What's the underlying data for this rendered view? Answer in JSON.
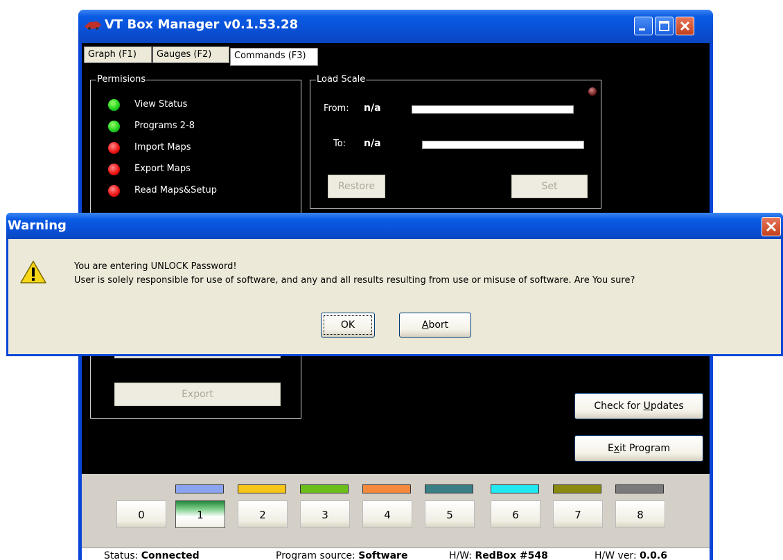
{
  "window": {
    "title": "VT Box Manager v0.1.53.28",
    "buttons": {
      "minimize": "_",
      "maximize": "□",
      "close": "✕"
    }
  },
  "tabs": [
    {
      "label": "Graph (F1)",
      "active": false
    },
    {
      "label": "Gauges (F2)",
      "active": false
    },
    {
      "label": "Commands (F3)",
      "active": true
    }
  ],
  "permissions": {
    "legend": "Permisions",
    "items": [
      {
        "label": "View Status",
        "state": "green"
      },
      {
        "label": "Programs 2-8",
        "state": "green"
      },
      {
        "label": "Import Maps",
        "state": "red"
      },
      {
        "label": "Export Maps",
        "state": "red"
      },
      {
        "label": "Read Maps&Setup",
        "state": "red"
      }
    ],
    "export_button": "Export"
  },
  "load_scale": {
    "legend": "Load Scale",
    "from_label": "From:",
    "from_value": "n/a",
    "to_label": "To:",
    "to_value": "n/a",
    "restore_button": "Restore",
    "set_button": "Set"
  },
  "actions": {
    "check_updates_pre": "Check for ",
    "check_updates_acc": "U",
    "check_updates_post": "pdates",
    "exit_pre": "E",
    "exit_acc": "x",
    "exit_post": "it Program"
  },
  "programs": [
    {
      "label": "0",
      "color": ""
    },
    {
      "label": "1",
      "color": "#8aa4f0",
      "active": true
    },
    {
      "label": "2",
      "color": "#f5c518"
    },
    {
      "label": "3",
      "color": "#6cbf1a"
    },
    {
      "label": "4",
      "color": "#f58a3c"
    },
    {
      "label": "5",
      "color": "#3a7f86"
    },
    {
      "label": "6",
      "color": "#22e8f0"
    },
    {
      "label": "7",
      "color": "#8a8a10"
    },
    {
      "label": "8",
      "color": "#7a7a7a"
    }
  ],
  "status": {
    "status_label": "Status: ",
    "status_value": "Connected",
    "source_label": "Program source: ",
    "source_value": "Software",
    "hw_label": "H/W: ",
    "hw_value": "RedBox #548",
    "hwver_label": "H/W ver: ",
    "hwver_value": "0.0.6"
  },
  "dialog": {
    "title": "Warning",
    "line1": "You are entering UNLOCK Password!",
    "line2": "User is solely responsible for use of software, and any and all results resulting from use or misuse of software. Are You sure?",
    "ok": "OK",
    "abort_acc": "A",
    "abort_rest": "bort",
    "close": "✕"
  }
}
